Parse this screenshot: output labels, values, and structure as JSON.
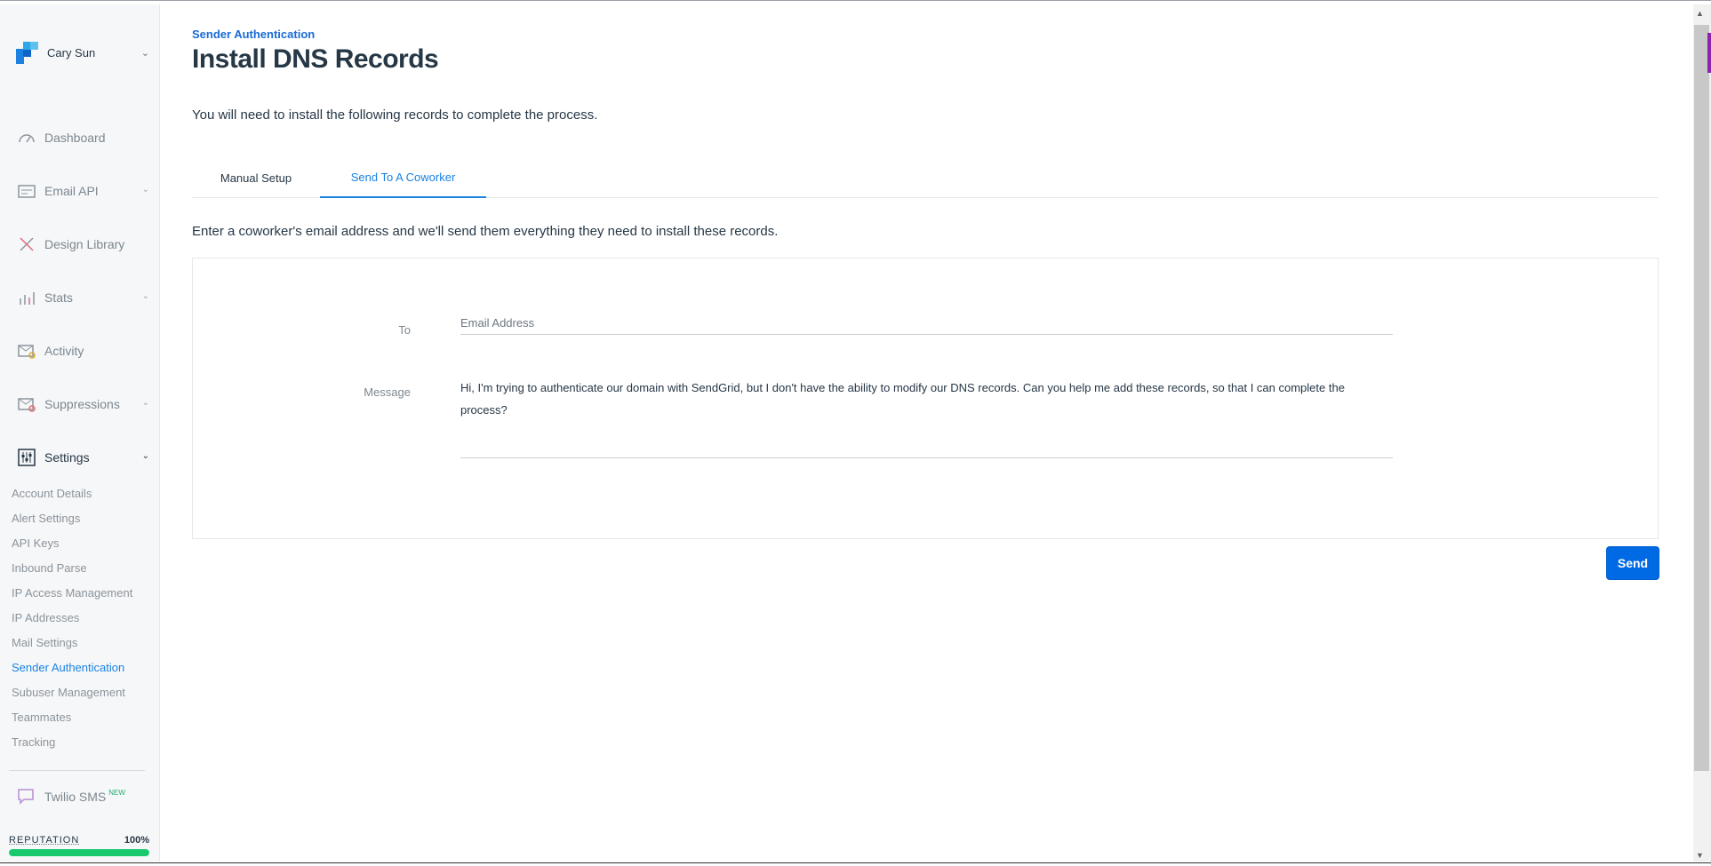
{
  "account": {
    "name": "Cary Sun"
  },
  "sidebar": {
    "items": [
      {
        "label": "Dashboard",
        "icon": "dashboard-icon"
      },
      {
        "label": "Email API",
        "icon": "email-api-icon"
      },
      {
        "label": "Design Library",
        "icon": "design-library-icon"
      },
      {
        "label": "Stats",
        "icon": "stats-icon"
      },
      {
        "label": "Activity",
        "icon": "activity-icon"
      },
      {
        "label": "Suppressions",
        "icon": "suppressions-icon"
      },
      {
        "label": "Settings",
        "icon": "settings-icon"
      }
    ],
    "settings_items": [
      "Account Details",
      "Alert Settings",
      "API Keys",
      "Inbound Parse",
      "IP Access Management",
      "IP Addresses",
      "Mail Settings",
      "Sender Authentication",
      "Subuser Management",
      "Teammates",
      "Tracking"
    ],
    "sms": {
      "label": "Twilio SMS",
      "badge": "NEW"
    },
    "reputation": {
      "label": "REPUTATION",
      "value": "100%",
      "fraction": 1.0
    }
  },
  "page": {
    "breadcrumb": "Sender Authentication",
    "title": "Install DNS Records",
    "intro": "You will need to install the following records to complete the process.",
    "tabs": [
      "Manual Setup",
      "Send To A Coworker"
    ],
    "description": "Enter a coworker's email address and we'll send them everything they need to install these records.",
    "to_label": "To",
    "email_placeholder": "Email Address",
    "message_label": "Message",
    "message": "Hi, I'm trying to authenticate our domain with SendGrid, but I don't have the ability to modify our DNS records. Can you help me add these records, so that I can complete the process?",
    "send_label": "Send"
  },
  "colors": {
    "accent": "#1a82e2",
    "send_button": "#0069e4",
    "reputation_bar": "#18c96e",
    "text": "#263746"
  }
}
